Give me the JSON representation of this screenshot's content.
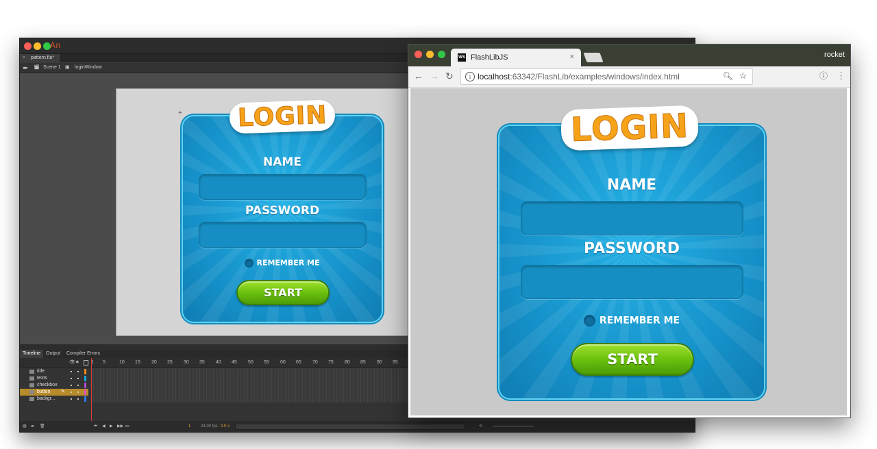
{
  "animate": {
    "app_logo": "An",
    "doc_tab": "pattern.fla*",
    "doc_tab_close": "×",
    "breadcrumb": {
      "scene": "Scene 1",
      "symbol": "loginWindow"
    },
    "panel_tabs": [
      "Timeline",
      "Output",
      "Compiler Errors"
    ],
    "frame_numbers": [
      "1",
      "5",
      "10",
      "15",
      "20",
      "25",
      "30",
      "35",
      "40",
      "45",
      "50",
      "55",
      "60",
      "65",
      "70",
      "75",
      "80",
      "85",
      "90",
      "95"
    ],
    "layers": [
      {
        "name": "title",
        "color": "#f08a1c"
      },
      {
        "name": "texts",
        "color": "#19a6e0"
      },
      {
        "name": "checkbox",
        "color": "#b04ad8"
      },
      {
        "name": "button",
        "color": "#e14fc0"
      },
      {
        "name": "backgr...",
        "color": "#2e7df0"
      }
    ],
    "selected_layer_index": 3,
    "status": {
      "frame": "1",
      "fps": "24.00 fps",
      "time": "0.0 s"
    },
    "stage_login": {
      "title": "LOGIN",
      "name_label": "NAME",
      "password_label": "PASSWORD",
      "remember_label": "REMEMBER ME",
      "start_label": "START"
    }
  },
  "browser": {
    "tab_title": "FlashLibJS",
    "tab_icon": "WS",
    "tab_close": "×",
    "profile_name": "rocket",
    "url_host": "localhost",
    "url_rest": ":63342/FlashLib/examples/windows/index.html",
    "info_icon": "i",
    "login": {
      "title": "LOGIN",
      "name_label": "NAME",
      "password_label": "PASSWORD",
      "remember_label": "REMEMBER ME",
      "start_label": "START"
    }
  },
  "colors": {
    "panel_blue": "#1a9fd6",
    "panel_border": "#62d3f3",
    "title_orange": "#f6a31a",
    "button_green": "#6bc10e",
    "browser_titlebar": "#3a3f33",
    "animate_orange": "#d6562b"
  },
  "icons": [
    "back-arrow-icon",
    "forward-arrow-icon",
    "reload-icon",
    "info-icon",
    "search-icon",
    "star-icon",
    "menu-dots-icon"
  ]
}
